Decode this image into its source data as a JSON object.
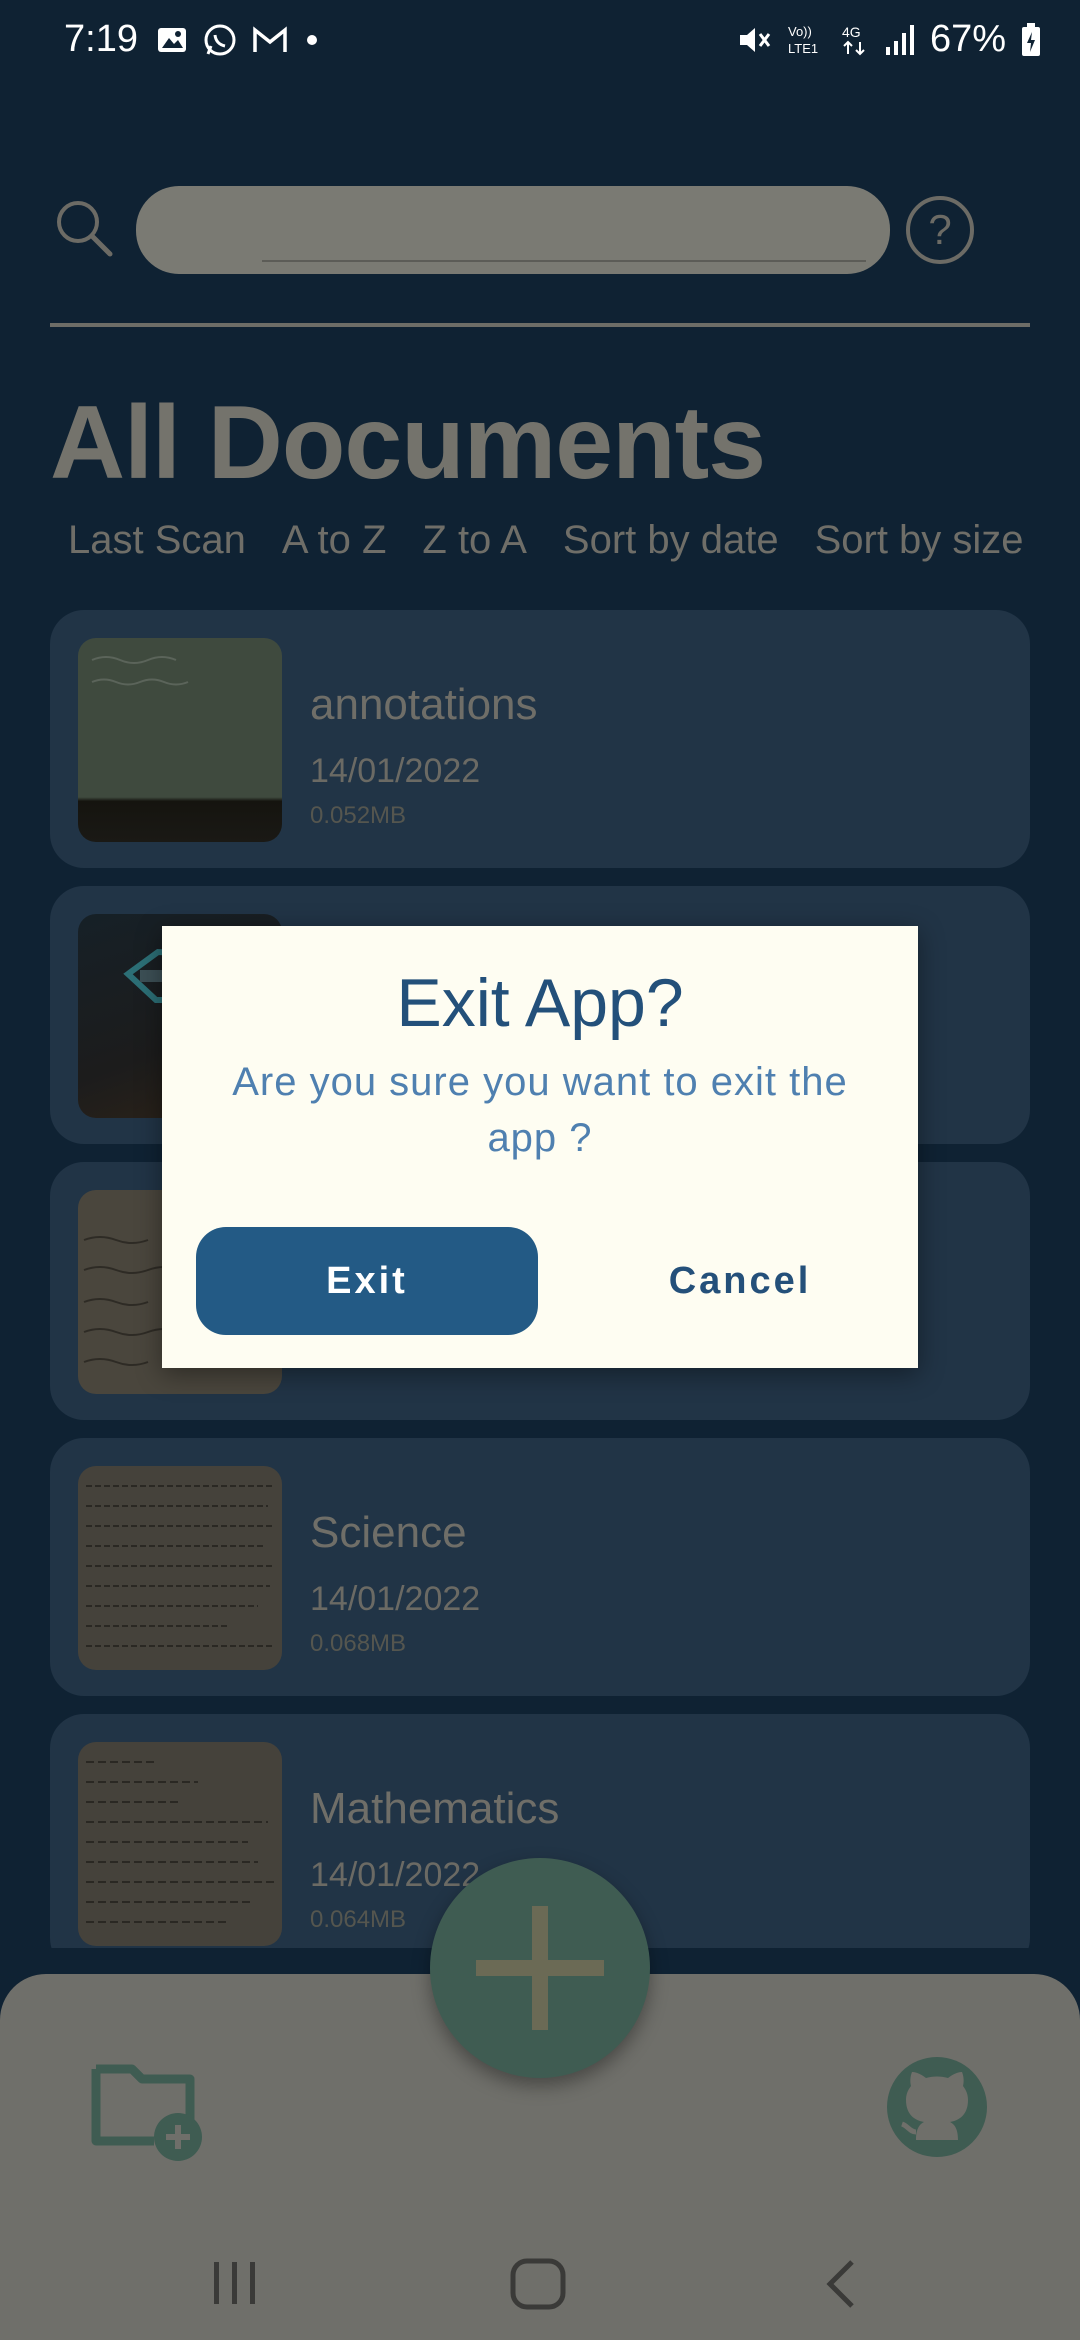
{
  "status_bar": {
    "time": "7:19",
    "battery": "67%",
    "network": "4G",
    "volte": "Vo)) LTE1"
  },
  "header": {
    "search_placeholder": "",
    "help_label": "?"
  },
  "title": "All Documents",
  "sort_options": [
    "Last Scan",
    "A to Z",
    "Z to A",
    "Sort by date",
    "Sort by size"
  ],
  "documents": [
    {
      "name": "annotations",
      "date": "14/01/2022",
      "size": "0.052MB"
    },
    {
      "name": "",
      "date": "",
      "size": ""
    },
    {
      "name": "",
      "date": "",
      "size": ""
    },
    {
      "name": "Science",
      "date": "14/01/2022",
      "size": "0.068MB"
    },
    {
      "name": "Mathematics",
      "date": "14/01/2022",
      "size": "0.064MB"
    }
  ],
  "dialog": {
    "title": "Exit App?",
    "message": "Are you sure you want to exit the app ?",
    "exit_label": "Exit",
    "cancel_label": "Cancel"
  },
  "icons": {
    "search": "search-icon",
    "help": "help-icon",
    "new_folder": "new-folder-icon",
    "github": "github-icon",
    "add": "plus-icon"
  },
  "colors": {
    "background": "#0f2233",
    "card": "#213446",
    "dialog_bg": "#fefdf2",
    "accent": "#235a85",
    "fab": "#3f5c52"
  }
}
